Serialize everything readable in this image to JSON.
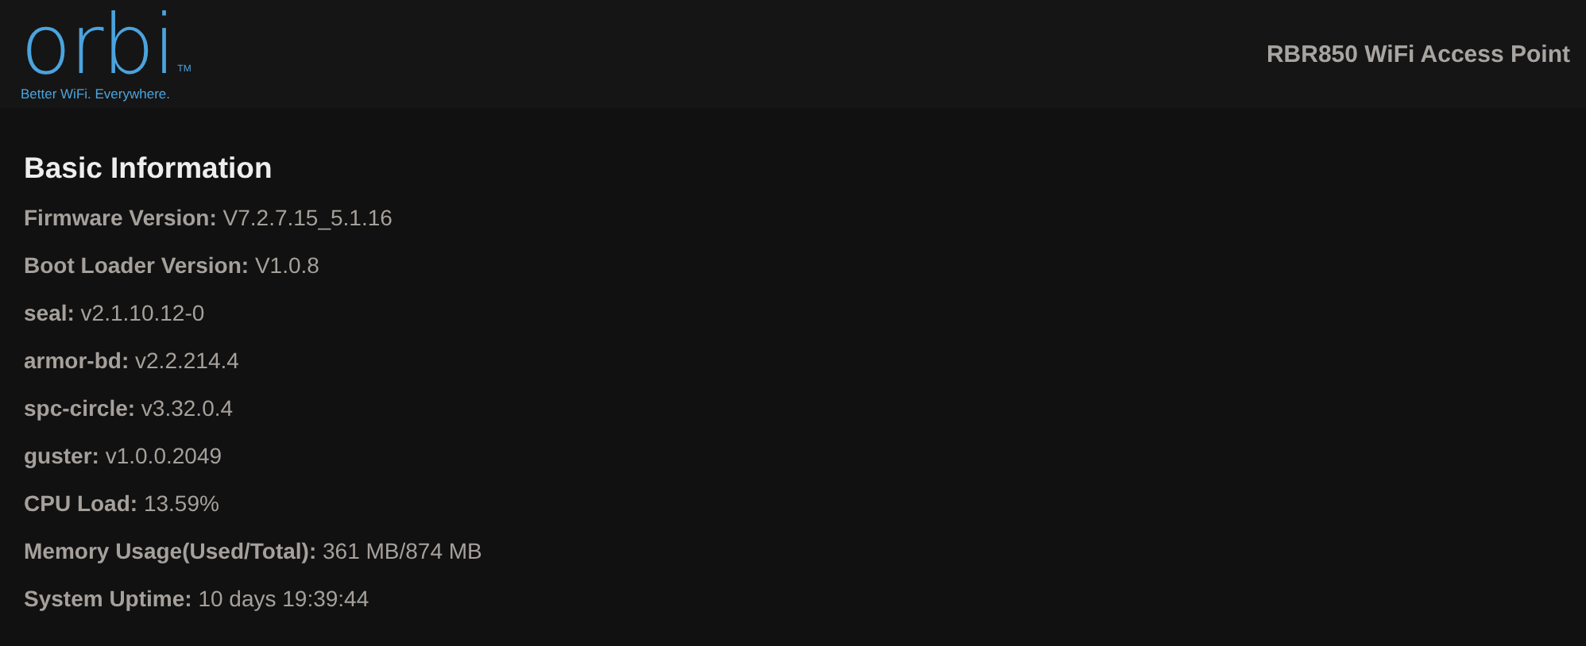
{
  "header": {
    "logo": "orbi",
    "trademark": "TM",
    "tagline": "Better WiFi. Everywhere.",
    "device_title": "RBR850 WiFi Access Point"
  },
  "section": {
    "title": "Basic Information",
    "items": [
      {
        "label": "Firmware Version:",
        "value": "V7.2.7.15_5.1.16"
      },
      {
        "label": "Boot Loader Version:",
        "value": "V1.0.8"
      },
      {
        "label": "seal:",
        "value": "v2.1.10.12-0"
      },
      {
        "label": "armor-bd:",
        "value": "v2.2.214.4"
      },
      {
        "label": "spc-circle:",
        "value": "v3.32.0.4"
      },
      {
        "label": "guster:",
        "value": "v1.0.0.2049"
      },
      {
        "label": "CPU Load:",
        "value": "13.59%"
      },
      {
        "label": "Memory Usage(Used/Total):",
        "value": "361 MB/874 MB"
      },
      {
        "label": "System Uptime:",
        "value": "10 days 19:39:44"
      }
    ]
  }
}
